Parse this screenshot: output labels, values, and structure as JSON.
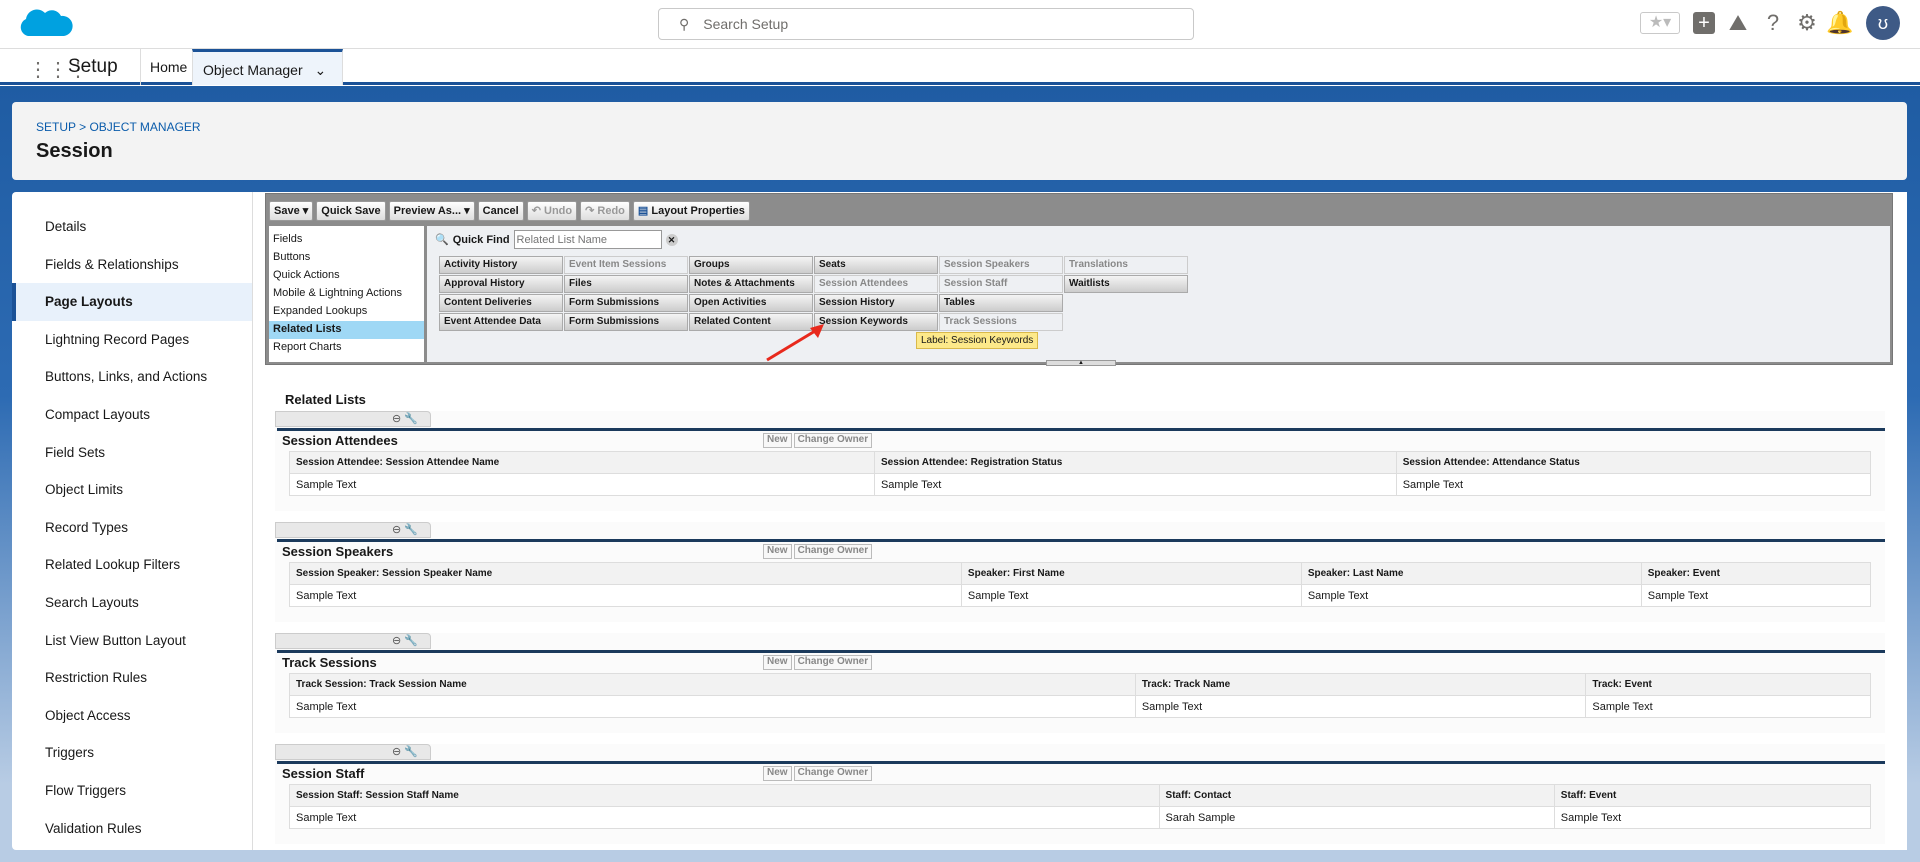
{
  "header": {
    "search_placeholder": "Search Setup",
    "icons": [
      "favorites-star-icon",
      "add-icon",
      "trailhead-icon",
      "help-icon",
      "setup-gear-icon",
      "notifications-bell-icon",
      "user-avatar"
    ]
  },
  "nav": {
    "app_name": "Setup",
    "tabs": [
      "Home",
      "Object Manager"
    ]
  },
  "breadcrumb": "SETUP > OBJECT MANAGER",
  "page_title": "Session",
  "sidebar": {
    "items": [
      "Details",
      "Fields & Relationships",
      "Page Layouts",
      "Lightning Record Pages",
      "Buttons, Links, and Actions",
      "Compact Layouts",
      "Field Sets",
      "Object Limits",
      "Record Types",
      "Related Lookup Filters",
      "Search Layouts",
      "List View Button Layout",
      "Restriction Rules",
      "Object Access",
      "Triggers",
      "Flow Triggers",
      "Validation Rules"
    ],
    "active": "Page Layouts"
  },
  "toolbar": {
    "save": "Save",
    "quick_save": "Quick Save",
    "preview": "Preview As...",
    "cancel": "Cancel",
    "undo": "Undo",
    "redo": "Redo",
    "layout_properties": "Layout Properties"
  },
  "palette": {
    "categories": [
      "Fields",
      "Buttons",
      "Quick Actions",
      "Mobile & Lightning Actions",
      "Expanded Lookups",
      "Related Lists",
      "Report Charts"
    ],
    "active": "Related Lists",
    "quick_find_label": "Quick Find",
    "quick_find_placeholder": "Related List Name",
    "items": [
      {
        "label": "Activity History",
        "state": "available"
      },
      {
        "label": "Event Item Sessions",
        "state": "used"
      },
      {
        "label": "Groups",
        "state": "available"
      },
      {
        "label": "Seats",
        "state": "available"
      },
      {
        "label": "Session Speakers",
        "state": "used"
      },
      {
        "label": "Translations",
        "state": "used"
      },
      {
        "label": "Approval History",
        "state": "available"
      },
      {
        "label": "Files",
        "state": "available"
      },
      {
        "label": "Notes & Attachments",
        "state": "available"
      },
      {
        "label": "Session Attendees",
        "state": "used"
      },
      {
        "label": "Session Staff",
        "state": "used"
      },
      {
        "label": "Waitlists",
        "state": "available"
      },
      {
        "label": "Content Deliveries",
        "state": "available"
      },
      {
        "label": "Form Submissions",
        "state": "available"
      },
      {
        "label": "Open Activities",
        "state": "available"
      },
      {
        "label": "Session History",
        "state": "available"
      },
      {
        "label": "Tables",
        "state": "available"
      },
      {
        "label": "",
        "state": "empty"
      },
      {
        "label": "Event Attendee Data",
        "state": "available"
      },
      {
        "label": "Form Submissions",
        "state": "available"
      },
      {
        "label": "Related Content",
        "state": "available"
      },
      {
        "label": "Session Keywords",
        "state": "selected"
      },
      {
        "label": "Track Sessions",
        "state": "used"
      },
      {
        "label": "",
        "state": "empty"
      }
    ],
    "tooltip": "Label: Session Keywords"
  },
  "related_lists": {
    "heading": "Related Lists",
    "new_label": "New",
    "change_owner_label": "Change Owner",
    "sections": [
      {
        "title": "Session Attendees",
        "columns": [
          "Session Attendee: Session Attendee Name",
          "Session Attendee: Registration Status",
          "Session Attendee: Attendance Status"
        ],
        "widths": [
          37,
          33,
          30
        ],
        "row": [
          "Sample Text",
          "Sample Text",
          "Sample Text"
        ]
      },
      {
        "title": "Session Speakers",
        "columns": [
          "Session Speaker: Session Speaker Name",
          "Speaker: First Name",
          "Speaker: Last Name",
          "Speaker: Event"
        ],
        "widths": [
          42.5,
          21.5,
          21.5,
          14.5
        ],
        "row": [
          "Sample Text",
          "Sample Text",
          "Sample Text",
          "Sample Text"
        ]
      },
      {
        "title": "Track Sessions",
        "columns": [
          "Track Session: Track Session Name",
          "Track: Track Name",
          "Track: Event"
        ],
        "widths": [
          53.5,
          28.5,
          18
        ],
        "row": [
          "Sample Text",
          "Sample Text",
          "Sample Text"
        ]
      },
      {
        "title": "Session Staff",
        "columns": [
          "Session Staff: Session Staff Name",
          "Staff: Contact",
          "Staff: Event"
        ],
        "widths": [
          55,
          25,
          20
        ],
        "row": [
          "Sample Text",
          "Sarah Sample",
          "Sample Text"
        ]
      }
    ]
  }
}
